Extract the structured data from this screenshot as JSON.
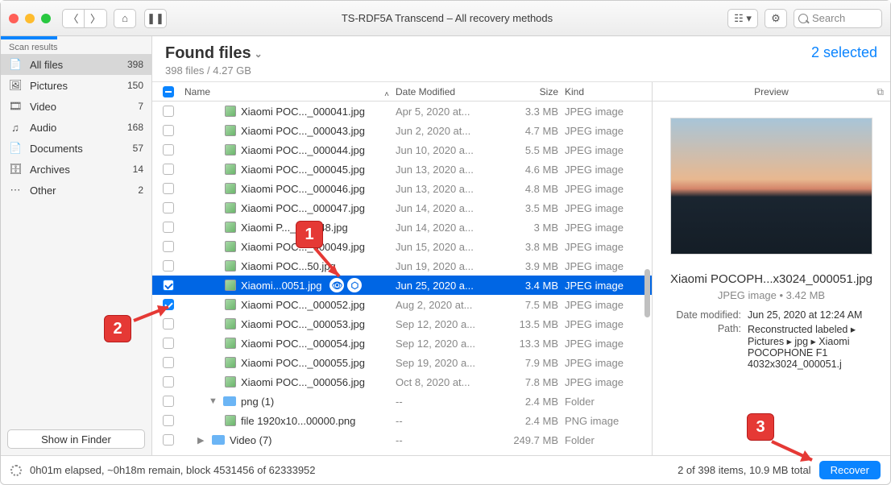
{
  "titlebar": {
    "title": "TS-RDF5A Transcend – All recovery methods",
    "search_placeholder": "Search"
  },
  "sidebar": {
    "header": "Scan results",
    "items": [
      {
        "icon": "📄",
        "label": "All files",
        "count": "398"
      },
      {
        "icon": "🖼",
        "label": "Pictures",
        "count": "150"
      },
      {
        "icon": "🎞",
        "label": "Video",
        "count": "7"
      },
      {
        "icon": "♫",
        "label": "Audio",
        "count": "168"
      },
      {
        "icon": "📄",
        "label": "Documents",
        "count": "57"
      },
      {
        "icon": "🗄",
        "label": "Archives",
        "count": "14"
      },
      {
        "icon": "⋯",
        "label": "Other",
        "count": "2"
      }
    ],
    "show_finder": "Show in Finder"
  },
  "main": {
    "title": "Found files",
    "subtitle": "398 files / 4.27 GB",
    "selected_text": "2 selected",
    "columns": {
      "name": "Name",
      "date": "Date Modified",
      "size": "Size",
      "kind": "Kind"
    },
    "files": [
      {
        "name": "Xiaomi POC..._000041.jpg",
        "date": "Apr 5, 2020 at...",
        "size": "3.3 MB",
        "kind": "JPEG image",
        "checked": false,
        "selected": false,
        "type": "file"
      },
      {
        "name": "Xiaomi POC..._000043.jpg",
        "date": "Jun 2, 2020 at...",
        "size": "4.7 MB",
        "kind": "JPEG image",
        "checked": false,
        "selected": false,
        "type": "file"
      },
      {
        "name": "Xiaomi POC..._000044.jpg",
        "date": "Jun 10, 2020 a...",
        "size": "5.5 MB",
        "kind": "JPEG image",
        "checked": false,
        "selected": false,
        "type": "file"
      },
      {
        "name": "Xiaomi POC..._000045.jpg",
        "date": "Jun 13, 2020 a...",
        "size": "4.6 MB",
        "kind": "JPEG image",
        "checked": false,
        "selected": false,
        "type": "file"
      },
      {
        "name": "Xiaomi POC..._000046.jpg",
        "date": "Jun 13, 2020 a...",
        "size": "4.8 MB",
        "kind": "JPEG image",
        "checked": false,
        "selected": false,
        "type": "file"
      },
      {
        "name": "Xiaomi POC..._000047.jpg",
        "date": "Jun 14, 2020 a...",
        "size": "3.5 MB",
        "kind": "JPEG image",
        "checked": false,
        "selected": false,
        "type": "file"
      },
      {
        "name": "Xiaomi P..._000048.jpg",
        "date": "Jun 14, 2020 a...",
        "size": "3 MB",
        "kind": "JPEG image",
        "checked": false,
        "selected": false,
        "type": "file"
      },
      {
        "name": "Xiaomi POC..._000049.jpg",
        "date": "Jun 15, 2020 a...",
        "size": "3.8 MB",
        "kind": "JPEG image",
        "checked": false,
        "selected": false,
        "type": "file"
      },
      {
        "name": "Xiaomi POC...50.jpg",
        "date": "Jun 19, 2020 a...",
        "size": "3.9 MB",
        "kind": "JPEG image",
        "checked": false,
        "selected": false,
        "type": "file"
      },
      {
        "name": "Xiaomi...0051.jpg",
        "date": "Jun 25, 2020 a...",
        "size": "3.4 MB",
        "kind": "JPEG image",
        "checked": true,
        "selected": true,
        "type": "file",
        "actions": true
      },
      {
        "name": "Xiaomi POC..._000052.jpg",
        "date": "Aug 2, 2020 at...",
        "size": "7.5 MB",
        "kind": "JPEG image",
        "checked": true,
        "selected": false,
        "type": "file"
      },
      {
        "name": "Xiaomi POC..._000053.jpg",
        "date": "Sep 12, 2020 a...",
        "size": "13.5 MB",
        "kind": "JPEG image",
        "checked": false,
        "selected": false,
        "type": "file"
      },
      {
        "name": "Xiaomi POC..._000054.jpg",
        "date": "Sep 12, 2020 a...",
        "size": "13.3 MB",
        "kind": "JPEG image",
        "checked": false,
        "selected": false,
        "type": "file"
      },
      {
        "name": "Xiaomi POC..._000055.jpg",
        "date": "Sep 19, 2020 a...",
        "size": "7.9 MB",
        "kind": "JPEG image",
        "checked": false,
        "selected": false,
        "type": "file"
      },
      {
        "name": "Xiaomi POC..._000056.jpg",
        "date": "Oct 8, 2020 at...",
        "size": "7.8 MB",
        "kind": "JPEG image",
        "checked": false,
        "selected": false,
        "type": "file"
      },
      {
        "name": "png (1)",
        "date": "--",
        "size": "2.4 MB",
        "kind": "Folder",
        "checked": false,
        "selected": false,
        "type": "folder",
        "disclosure": "▼",
        "indent": 28
      },
      {
        "name": "file 1920x10...00000.png",
        "date": "--",
        "size": "2.4 MB",
        "kind": "PNG image",
        "checked": false,
        "selected": false,
        "type": "file"
      },
      {
        "name": "Video (7)",
        "date": "--",
        "size": "249.7 MB",
        "kind": "Folder",
        "checked": false,
        "selected": false,
        "type": "folder",
        "disclosure": "▶",
        "indent": 14
      }
    ]
  },
  "preview": {
    "header": "Preview",
    "filename": "Xiaomi POCOPH...x3024_000051.jpg",
    "meta": "JPEG image • 3.42 MB",
    "details": [
      {
        "k": "Date modified:",
        "v": "Jun 25, 2020 at 12:24 AM"
      },
      {
        "k": "Path:",
        "v": "Reconstructed labeled ▸ Pictures ▸ jpg ▸ Xiaomi POCOPHONE F1 4032x3024_000051.j"
      }
    ]
  },
  "footer": {
    "status": "0h01m elapsed, ~0h18m remain, block 4531456 of 62333952",
    "totals": "2 of 398 items, 10.9 MB total",
    "recover": "Recover"
  },
  "markers": {
    "m1": "1",
    "m2": "2",
    "m3": "3"
  }
}
